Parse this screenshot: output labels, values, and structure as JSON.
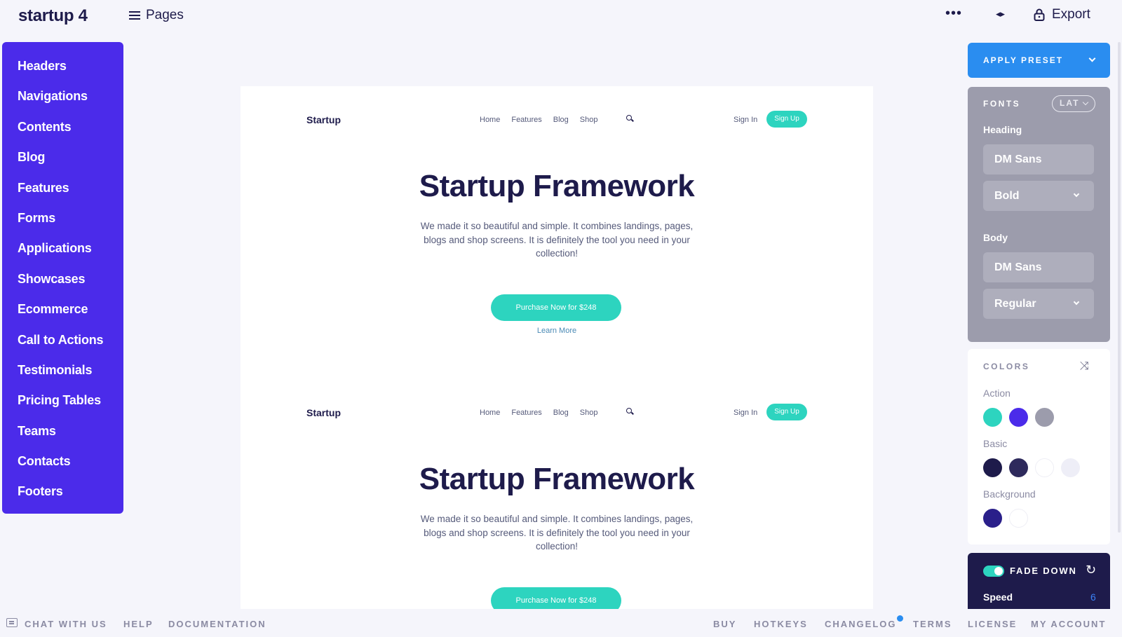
{
  "header": {
    "brand": "startup 4",
    "pages_label": "Pages",
    "more_icon": "•••",
    "code_icon": "◂▸",
    "export_label": "Export"
  },
  "sidebar": {
    "items": [
      {
        "label": "Headers"
      },
      {
        "label": "Navigations"
      },
      {
        "label": "Contents"
      },
      {
        "label": "Blog"
      },
      {
        "label": "Features"
      },
      {
        "label": "Forms"
      },
      {
        "label": "Applications"
      },
      {
        "label": "Showcases"
      },
      {
        "label": "Ecommerce"
      },
      {
        "label": "Call to Actions"
      },
      {
        "label": "Testimonials"
      },
      {
        "label": "Pricing Tables"
      },
      {
        "label": "Teams"
      },
      {
        "label": "Contacts"
      },
      {
        "label": "Footers"
      }
    ]
  },
  "canvas": {
    "sections": [
      {
        "logo": "Startup",
        "links": [
          "Home",
          "Features",
          "Blog",
          "Shop"
        ],
        "signin": "Sign In",
        "signup": "Sign Up",
        "title": "Startup Framework",
        "text": "We made it so beautiful and simple. It combines landings, pages, blogs and shop screens. It is definitely the tool you need in your collection!",
        "button": "Purchase Now for $248",
        "more": "Learn More"
      },
      {
        "logo": "Startup",
        "links": [
          "Home",
          "Features",
          "Blog",
          "Shop"
        ],
        "signin": "Sign In",
        "signup": "Sign Up",
        "title": "Startup Framework",
        "text": "We made it so beautiful and simple. It combines landings, pages, blogs and shop screens. It is definitely the tool you need in your collection!",
        "button": "Purchase Now for $248"
      }
    ]
  },
  "panel": {
    "apply_preset": "APPLY PRESET",
    "fonts": {
      "label": "FONTS",
      "lang": "LAT",
      "heading_label": "Heading",
      "heading_font": "DM Sans",
      "heading_weight": "Bold",
      "body_label": "Body",
      "body_font": "DM Sans",
      "body_weight": "Regular"
    },
    "colors": {
      "label": "COLORS",
      "shuffle_icon": "⤨",
      "action_label": "Action",
      "action": [
        "#2dd4bf",
        "#4b2bea",
        "#9c9cac"
      ],
      "basic_label": "Basic",
      "basic": [
        "#1e1b4b",
        "#2e2a5c",
        "#ffffff",
        "#eeeef7"
      ],
      "background_label": "Background",
      "background": [
        "#2a1f8a",
        "#ffffff"
      ]
    },
    "animation": {
      "label": "FADE DOWN",
      "refresh_icon": "↻",
      "speed_label": "Speed",
      "speed_value": "6",
      "enabled": true
    }
  },
  "footer": {
    "left": [
      "CHAT WITH US",
      "HELP",
      "DOCUMENTATION"
    ],
    "right": [
      "BUY",
      "HOTKEYS",
      "CHANGELOG",
      "TERMS",
      "LICENSE",
      "MY ACCOUNT"
    ]
  }
}
